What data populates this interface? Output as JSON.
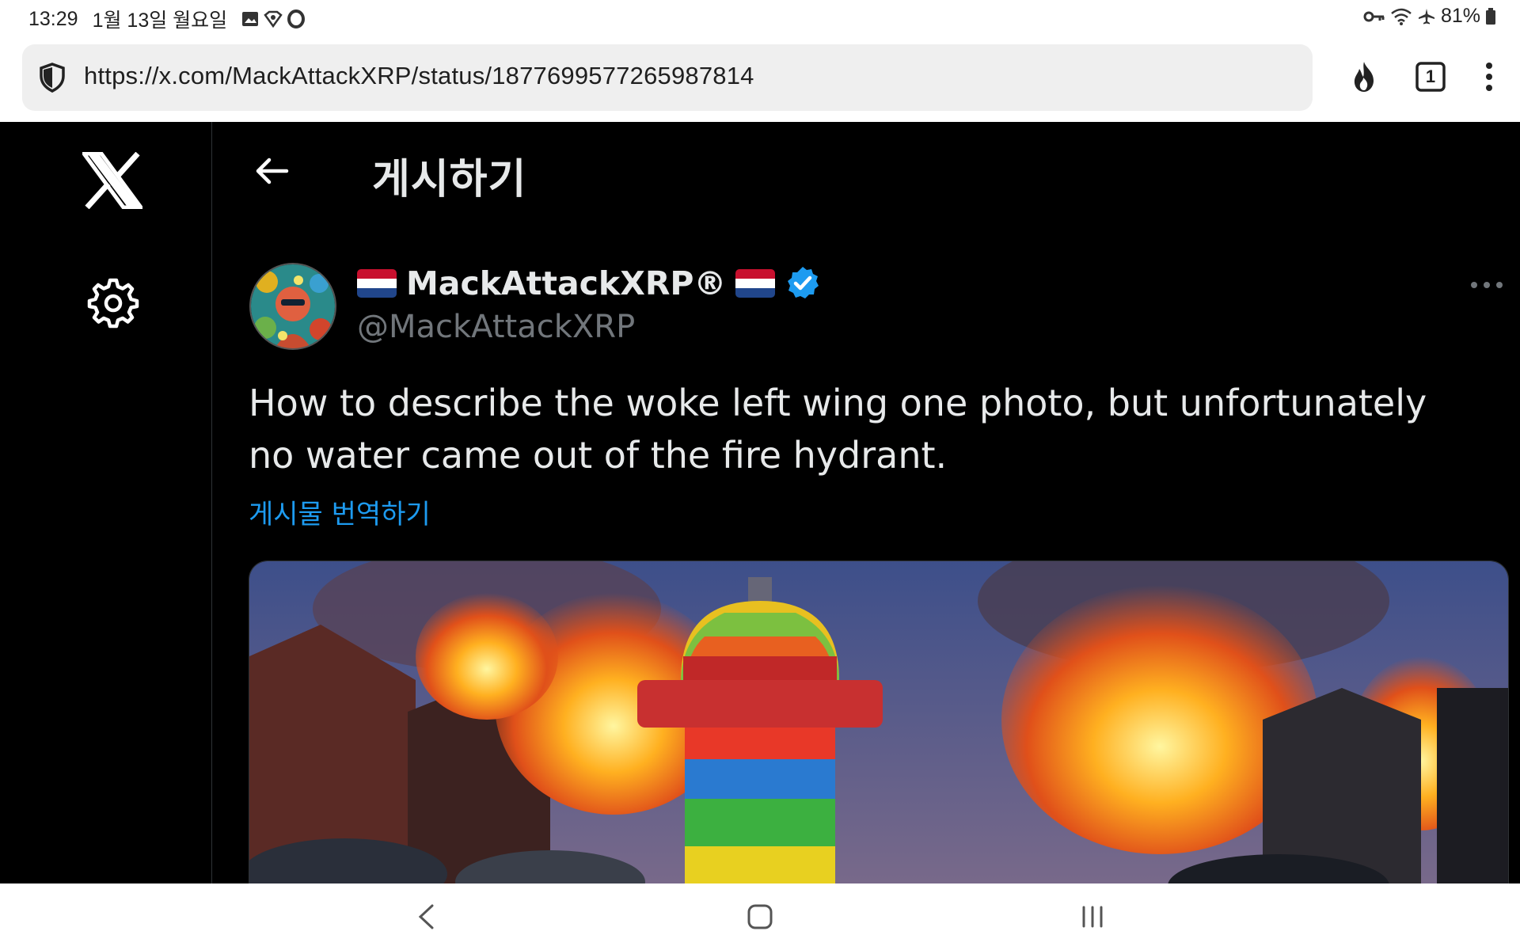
{
  "status_bar": {
    "time": "13:29",
    "date": "1월 13일 월요일",
    "notification_icons": [
      "gallery-icon",
      "vpn-icon",
      "opera-icon"
    ],
    "system_icons": [
      "key-icon",
      "wifi-icon",
      "airplane-icon"
    ],
    "battery": "81%"
  },
  "browser": {
    "url": "https://x.com/MackAttackXRP/status/1877699577265987814",
    "tab_count": "1",
    "icons": [
      "shield-icon",
      "flame-icon",
      "tabs-icon",
      "more-vertical-icon"
    ]
  },
  "app": {
    "header_title": "게시하기",
    "tweet": {
      "display_name": "MackAttackXRP®",
      "handle": "@MackAttackXRP",
      "text": "How to describe the woke left wing one photo, but unfortunately no water came out of the fire hydrant.",
      "translate_label": "게시물 번역하기"
    },
    "colors": {
      "background": "#000000",
      "text": "#e7e9ea",
      "secondary": "#71767b",
      "accent": "#1d9bf0"
    }
  },
  "navigation": {
    "icons": [
      "back-icon",
      "home-icon",
      "recents-icon"
    ]
  }
}
